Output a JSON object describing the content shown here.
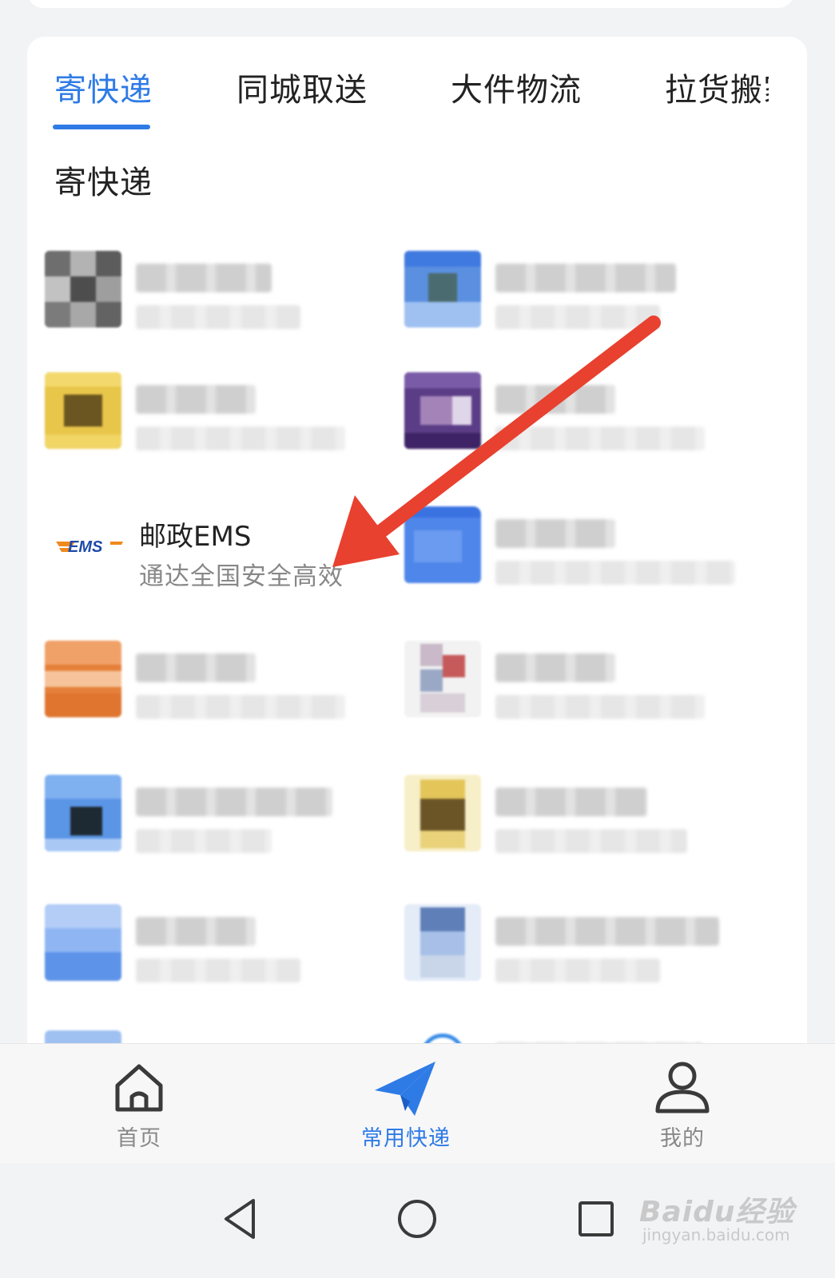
{
  "tabs": [
    {
      "label": "寄快递",
      "active": true
    },
    {
      "label": "同城取送",
      "active": false
    },
    {
      "label": "大件物流",
      "active": false
    },
    {
      "label": "拉货搬家",
      "active": false
    }
  ],
  "section_title": "寄快递",
  "featured_item": {
    "logo_text": "EMS",
    "name": "邮政EMS",
    "description": "通达全国安全高效"
  },
  "bottom_nav": [
    {
      "label": "首页",
      "icon": "home-icon",
      "active": false
    },
    {
      "label": "常用快递",
      "icon": "paper-plane-icon",
      "active": true
    },
    {
      "label": "我的",
      "icon": "user-icon",
      "active": false
    }
  ],
  "system_nav": {
    "back": "back-icon",
    "home": "home-circle-icon",
    "recent": "recent-apps-icon"
  },
  "watermark": {
    "main": "Baidu经验",
    "sub": "jingyan.baidu.com"
  },
  "colors": {
    "accent": "#2f7be6",
    "annotation_arrow": "#e8412f",
    "ems_blue": "#1f4aa8",
    "ems_orange": "#f08a1c"
  }
}
